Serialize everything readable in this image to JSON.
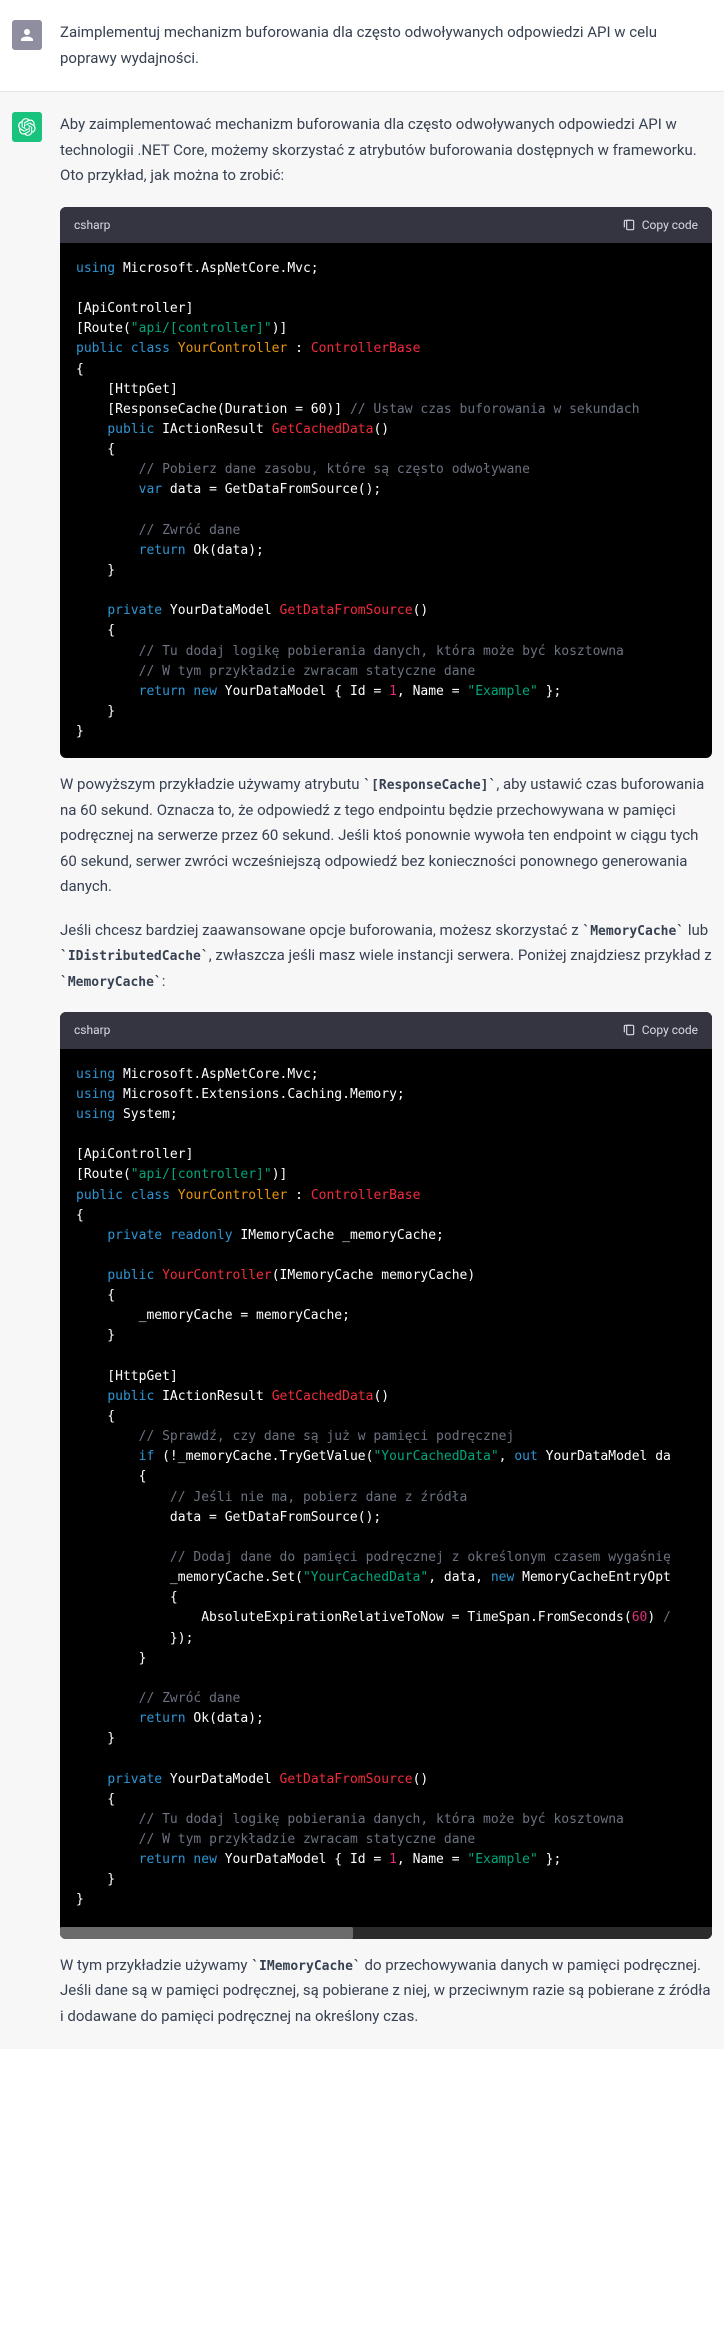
{
  "user_message": "Zaimplementuj mechanizm buforowania dla często odwoływanych odpowiedzi API w celu poprawy wydajności.",
  "assistant": {
    "intro": "Aby zaimplementować mechanizm buforowania dla często odwoływanych odpowiedzi API w technologii .NET Core, możemy skorzystać z atrybutów buforowania dostępnych w frameworku. Oto przykład, jak można to zrobić:",
    "para2_a": "W powyższym przykładzie używamy atrybutu ",
    "para2_code": "`[ResponseCache]`",
    "para2_b": ", aby ustawić czas buforowania na 60 sekund. Oznacza to, że odpowiedź z tego endpointu będzie przechowywana w pamięci podręcznej na serwerze przez 60 sekund. Jeśli ktoś ponownie wywoła ten endpoint w ciągu tych 60 sekund, serwer zwróci wcześniejszą odpowiedź bez konieczności ponownego generowania danych.",
    "para3_a": "Jeśli chcesz bardziej zaawansowane opcje buforowania, możesz skorzystać z ",
    "para3_code1": "`MemoryCache`",
    "para3_mid": " lub ",
    "para3_code2": "`IDistributedCache`",
    "para3_b": ", zwłaszcza jeśli masz wiele instancji serwera. Poniżej znajdziesz przykład z ",
    "para3_code3": "`MemoryCache`",
    "para3_end": ":",
    "para4_a": "W tym przykładzie używamy ",
    "para4_code": "`IMemoryCache`",
    "para4_b": " do przechowywania danych w pamięci podręcznej. Jeśli dane są w pamięci podręcznej, są pobierane z niej, w przeciwnym razie są pobierane z źródła i dodawane do pamięci podręcznej na określony czas."
  },
  "code1": {
    "lang": "csharp",
    "copy": "Copy code"
  },
  "code2": {
    "lang": "csharp",
    "copy": "Copy code"
  }
}
